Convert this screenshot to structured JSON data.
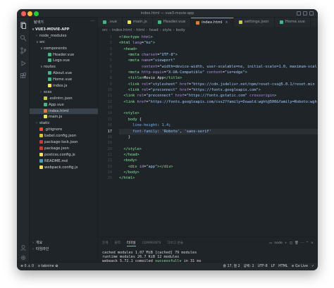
{
  "window": {
    "title": "index.html — vue3-movie-app"
  },
  "sidebar": {
    "header": "탐색기",
    "more": "···",
    "tree": [
      {
        "label": "VUE3-MOVIE-APP",
        "kind": "root",
        "chev": "∨",
        "indent": 0
      },
      {
        "label": "node_modules",
        "kind": "folder",
        "chev": "›",
        "indent": 1
      },
      {
        "label": "src",
        "kind": "folder",
        "chev": "∨",
        "indent": 1
      },
      {
        "label": "components",
        "kind": "folder",
        "chev": "∨",
        "indent": 2
      },
      {
        "label": "Header.vue",
        "kind": "vue",
        "indent": 3
      },
      {
        "label": "Logo.vue",
        "kind": "vue",
        "indent": 3
      },
      {
        "label": "routes",
        "kind": "folder",
        "chev": "∨",
        "indent": 2
      },
      {
        "label": "About.vue",
        "kind": "vue",
        "indent": 3
      },
      {
        "label": "Home.vue",
        "kind": "vue",
        "indent": 3
      },
      {
        "label": "index.js",
        "kind": "js",
        "indent": 3
      },
      {
        "label": "scss",
        "kind": "folder",
        "chev": "›",
        "indent": 2
      },
      {
        "label": ".eslintrc.json",
        "kind": "json",
        "indent": 2
      },
      {
        "label": "App.vue",
        "kind": "vue",
        "indent": 2
      },
      {
        "label": "index.html",
        "kind": "html",
        "indent": 2,
        "selected": true
      },
      {
        "label": "main.js",
        "kind": "js",
        "indent": 2
      },
      {
        "label": "static",
        "kind": "folder",
        "chev": "›",
        "indent": 1
      },
      {
        "label": ".gitignore",
        "kind": "git",
        "indent": 1
      },
      {
        "label": "babel.config.json",
        "kind": "json",
        "indent": 1
      },
      {
        "label": "package-lock.json",
        "kind": "npm",
        "indent": 1
      },
      {
        "label": "package.json",
        "kind": "npm",
        "indent": 1
      },
      {
        "label": "postcss.config.js",
        "kind": "js",
        "indent": 1
      },
      {
        "label": "README.md",
        "kind": "md",
        "indent": 1
      },
      {
        "label": "webpack.config.js",
        "kind": "js",
        "indent": 1
      }
    ],
    "outline": [
      {
        "label": "개요",
        "chev": "›"
      },
      {
        "label": "타임라인",
        "chev": "›"
      }
    ]
  },
  "tabs": [
    {
      "label": ".vue",
      "icon": "vue"
    },
    {
      "label": "main.js",
      "icon": "js"
    },
    {
      "label": "Header.vue",
      "icon": "vue"
    },
    {
      "label": "index.html",
      "icon": "html",
      "active": true,
      "close": "×"
    },
    {
      "label": "settings.json",
      "icon": "json"
    },
    {
      "label": "Home.vue",
      "icon": "vue"
    }
  ],
  "breadcrumb": [
    "src",
    "index.html",
    "html",
    "head",
    "style",
    "body"
  ],
  "editor": {
    "current_line": 17,
    "lines": [
      {
        "n": 1,
        "t": [
          [
            "<!",
            "tg"
          ],
          [
            "doctype ",
            "tg"
          ],
          [
            "html",
            "at"
          ],
          [
            ">",
            "tg"
          ]
        ]
      },
      {
        "n": 2,
        "t": [
          [
            "<html ",
            "tg"
          ],
          [
            "lang",
            "at"
          ],
          [
            "=",
            "pn"
          ],
          [
            "\"ko\"",
            "st"
          ],
          [
            ">",
            "tg"
          ]
        ]
      },
      {
        "n": 3,
        "t": [
          [
            "  <head>",
            "tg"
          ]
        ]
      },
      {
        "n": 4,
        "t": [
          [
            "    <meta ",
            "tg"
          ],
          [
            "charset",
            "at"
          ],
          [
            "=",
            "pn"
          ],
          [
            "\"UTF-8\"",
            "st"
          ],
          [
            ">",
            "tg"
          ]
        ]
      },
      {
        "n": 5,
        "t": [
          [
            "    <meta ",
            "tg"
          ],
          [
            "name",
            "at"
          ],
          [
            "=",
            "pn"
          ],
          [
            "\"viewport\"",
            "st"
          ]
        ]
      },
      {
        "n": 6,
        "t": [
          [
            "          ",
            "pn"
          ],
          [
            "content",
            "at"
          ],
          [
            "=",
            "pn"
          ],
          [
            "\"width=device-width, user-scalable=no, initial-scale=1.0, maximum-scal",
            "st"
          ]
        ]
      },
      {
        "n": 7,
        "t": [
          [
            "    <meta ",
            "tg"
          ],
          [
            "http-equiv",
            "at"
          ],
          [
            "=",
            "pn"
          ],
          [
            "\"X-UA-Compatible\"",
            "st"
          ],
          [
            " content",
            "at"
          ],
          [
            "=",
            "pn"
          ],
          [
            "\"ie=edge\"",
            "st"
          ],
          [
            ">",
            "tg"
          ]
        ]
      },
      {
        "n": 8,
        "t": [
          [
            "    <title>",
            "tg"
          ],
          [
            "Movie App",
            "pn"
          ],
          [
            "</title>",
            "tg"
          ]
        ]
      },
      {
        "n": 9,
        "t": [
          [
            "    <link ",
            "tg"
          ],
          [
            "rel",
            "at"
          ],
          [
            "=",
            "pn"
          ],
          [
            "\"stylesheet\"",
            "st"
          ],
          [
            " href",
            "at"
          ],
          [
            "=",
            "pn"
          ],
          [
            "\"https://cdn.jsdelivr.net/npm/reset-css@5.0.1/reset.min",
            "st"
          ]
        ]
      },
      {
        "n": 10,
        "t": [
          [
            "    <link ",
            "tg"
          ],
          [
            "rel",
            "at"
          ],
          [
            "=",
            "pn"
          ],
          [
            "\"preconnect\"",
            "st"
          ],
          [
            " href",
            "at"
          ],
          [
            "=",
            "pn"
          ],
          [
            "\"https://fonts.googleapis.com\"",
            "st"
          ],
          [
            ">",
            "tg"
          ]
        ]
      },
      {
        "n": 11,
        "t": [
          [
            "  <link ",
            "tg"
          ],
          [
            "rel",
            "at"
          ],
          [
            "=",
            "pn"
          ],
          [
            "\"preconnect\"",
            "st"
          ],
          [
            " href",
            "at"
          ],
          [
            "=",
            "pn"
          ],
          [
            "\"https://fonts.gstatic.com\"",
            "st"
          ],
          [
            " crossorigin",
            "at"
          ],
          [
            ">",
            "tg"
          ]
        ]
      },
      {
        "n": 12,
        "t": [
          [
            "  <link ",
            "tg"
          ],
          [
            "href",
            "at"
          ],
          [
            "=",
            "pn"
          ],
          [
            "\"https://fonts.googleapis.com/css2?family=Oswald:wght@500&family=Roboto:wgh",
            "st"
          ]
        ]
      },
      {
        "n": 13,
        "t": [
          [
            "",
            "pn"
          ]
        ]
      },
      {
        "n": 14,
        "t": [
          [
            "  <style>",
            "tg"
          ]
        ]
      },
      {
        "n": 15,
        "t": [
          [
            "    body ",
            "tg"
          ],
          [
            "{",
            "pn"
          ]
        ]
      },
      {
        "n": 16,
        "t": [
          [
            "      ",
            "pn"
          ],
          [
            "line-height",
            "pr"
          ],
          [
            ": ",
            "pn"
          ],
          [
            "1.4",
            "pr"
          ],
          [
            ";",
            "pn"
          ]
        ]
      },
      {
        "n": 17,
        "t": [
          [
            "      ",
            "pn"
          ],
          [
            "font-family",
            "pr"
          ],
          [
            ": ",
            "pn"
          ],
          [
            "'Roboto'",
            "st"
          ],
          [
            ", ",
            "pn"
          ],
          [
            "'sans-serif'",
            "st"
          ]
        ]
      },
      {
        "n": 18,
        "t": [
          [
            "    }",
            "pn"
          ]
        ]
      },
      {
        "n": 19,
        "t": [
          [
            "",
            "pn"
          ]
        ]
      },
      {
        "n": 20,
        "t": [
          [
            "  </style>",
            "tg"
          ]
        ]
      },
      {
        "n": 21,
        "t": [
          [
            "  </head>",
            "tg"
          ]
        ]
      },
      {
        "n": 22,
        "t": [
          [
            "  <body>",
            "tg"
          ]
        ]
      },
      {
        "n": 23,
        "t": [
          [
            "    <div ",
            "tg"
          ],
          [
            "id",
            "at"
          ],
          [
            "=",
            "pn"
          ],
          [
            "\"app\"",
            "st"
          ],
          [
            "></div>",
            "tg"
          ]
        ]
      },
      {
        "n": 24,
        "t": [
          [
            "  </body>",
            "tg"
          ]
        ]
      },
      {
        "n": 25,
        "t": [
          [
            "</html>",
            "tg"
          ]
        ]
      }
    ]
  },
  "panel": {
    "tabs": [
      {
        "label": "문제"
      },
      {
        "label": "출력"
      },
      {
        "label": "터미널",
        "active": true
      },
      {
        "label": "COMMENTS"
      },
      {
        "label": "디버그 콘솔"
      }
    ],
    "terminal_label": "node",
    "terminal_lines": [
      {
        "text": "cached modules 1.07 MiB [cached] 79 modules"
      },
      {
        "text": "runtime modules 26.7 KiB 12 modules"
      },
      {
        "prefix": "webpack 5.72.1 compiled ",
        "ok": "successfully",
        "suffix": " in 31 ms"
      }
    ]
  },
  "statusbar": {
    "left": [
      "⊗ 0  ⚠ 0",
      "o tabnine ✿"
    ],
    "right": [
      "줄 17, 열 2",
      "공백: 2",
      "UTF-8",
      "LF",
      "HTML",
      "⊘ Go Live",
      "✓"
    ]
  },
  "colors": {
    "accent": "#f9826c",
    "editor_bg": "#1f2428",
    "chrome_bg": "#24292e",
    "tag": "#85e89d",
    "attr": "#b392f0",
    "string": "#9ecbff"
  }
}
